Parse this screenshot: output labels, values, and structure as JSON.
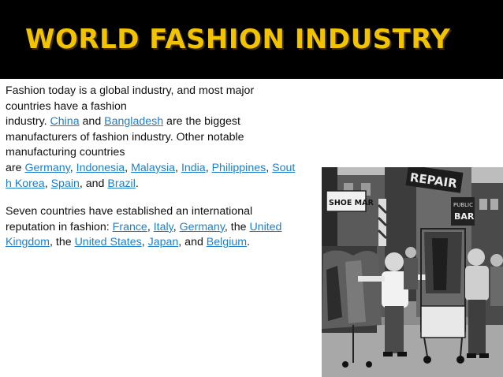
{
  "slide": {
    "title": "WORLD FASHION INDUSTRY",
    "title_color": "#f2c300",
    "header_bg": "#000000",
    "link_color": "#1f7fc8"
  },
  "paragraph1": {
    "line1": "Fashion today is a global industry, and most major",
    "line2": "countries have a fashion",
    "p3": "industry. ",
    "link_china": "China",
    "p4": " and ",
    "link_bangladesh": "Bangladesh",
    "p5": " are the biggest",
    "line5": "manufacturers of fashion industry. Other notable",
    "line6": "manufacturing countries",
    "p7": "are ",
    "link_germany": "Germany",
    "c1": ", ",
    "link_indonesia": "Indonesia",
    "c2": ", ",
    "link_malaysia": "Malaysia",
    "c3": ", ",
    "link_india": "India",
    "c4": ", ",
    "link_philippines": "Philippines",
    "c5": ", ",
    "link_south_korea_a": "Sout",
    "link_south_korea_b": "h Korea",
    "c6": ", ",
    "link_spain": "Spain",
    "c7": ", and ",
    "link_brazil": "Brazil",
    "end": "."
  },
  "paragraph2": {
    "line1": "Seven countries have established an international",
    "p2": "reputation in fashion: ",
    "link_france": "France",
    "c1": ", ",
    "link_italy": "Italy",
    "c2": ", ",
    "link_germany": "Germany",
    "c3": ", the ",
    "link_uk_a": "United",
    "link_uk_b": "Kingdom",
    "c4": ", the ",
    "link_us": "United States",
    "c5": ", ",
    "link_japan": "Japan",
    "c6": ", and ",
    "link_belgium": "Belgium",
    "end": "."
  },
  "photo": {
    "sign_repair": "REPAIR",
    "sign_shoe": "SHOE MAR",
    "sign_bar": "BAR",
    "sign_public": "PUBLIC"
  }
}
